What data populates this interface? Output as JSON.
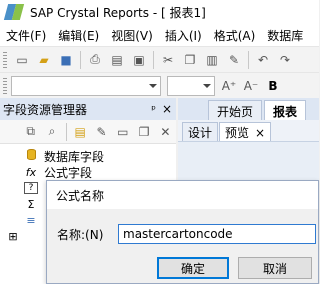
{
  "window": {
    "title": "SAP Crystal Reports - [ 报表1]"
  },
  "menu": [
    "文件(F)",
    "编辑(E)",
    "视图(V)",
    "插入(I)",
    "格式(A)",
    "数据库"
  ],
  "field_explorer": {
    "title": "字段资源管理器",
    "pin": "ᵖ",
    "close": "×",
    "items": [
      {
        "icon": "fx",
        "label": "数据库字段"
      },
      {
        "icon": "fx",
        "label": "公式字段"
      },
      {
        "icon": "?",
        "label": ""
      },
      {
        "icon": "Σ",
        "label": ""
      },
      {
        "icon": "≡",
        "label": ""
      },
      {
        "icon": "⊞",
        "label": ""
      }
    ]
  },
  "doc_tabs": [
    {
      "label": "开始页"
    },
    {
      "label": "报表"
    }
  ],
  "view_tabs": [
    {
      "label": "设计"
    },
    {
      "label": "预览",
      "close": "×"
    }
  ],
  "dialog": {
    "title": "公式名称",
    "field_label": "名称:(N)",
    "field_value": "mastercartoncode",
    "ok_label": "确定",
    "cancel_label": "取消"
  }
}
